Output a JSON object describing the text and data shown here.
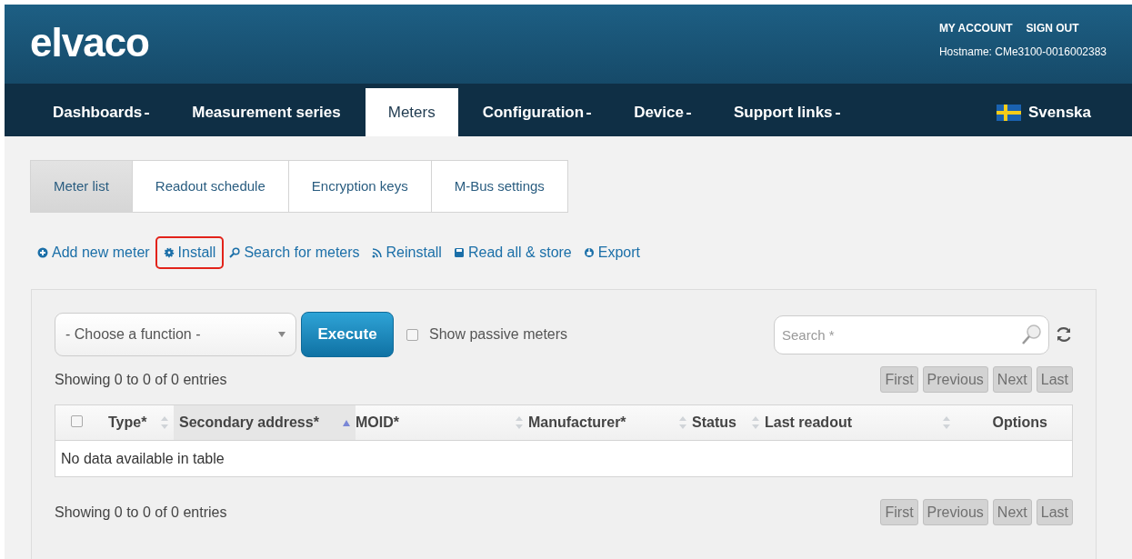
{
  "header": {
    "logo": "elvaco",
    "links": [
      "MY ACCOUNT",
      "SIGN OUT"
    ],
    "hostname": "Hostname: CMe3100-0016002383"
  },
  "nav": [
    {
      "label": "Dashboards",
      "dropdown": true,
      "selected": false
    },
    {
      "label": "Measurement series",
      "dropdown": false,
      "selected": false
    },
    {
      "label": "Meters",
      "dropdown": false,
      "selected": true
    },
    {
      "label": "Configuration",
      "dropdown": true,
      "selected": false
    },
    {
      "label": "Device",
      "dropdown": true,
      "selected": false
    },
    {
      "label": "Support links",
      "dropdown": true,
      "selected": false
    }
  ],
  "language": "Svenska",
  "subtabs": [
    {
      "label": "Meter list",
      "selected": true
    },
    {
      "label": "Readout schedule",
      "selected": false
    },
    {
      "label": "Encryption keys",
      "selected": false
    },
    {
      "label": "M-Bus settings",
      "selected": false
    }
  ],
  "actions": [
    {
      "label": "Add new meter",
      "kind": "plus",
      "highlighted": false
    },
    {
      "label": "Install",
      "kind": "gear",
      "highlighted": true
    },
    {
      "label": "Search for meters",
      "kind": "search",
      "highlighted": false
    },
    {
      "label": "Reinstall",
      "kind": "rss",
      "highlighted": false
    },
    {
      "label": "Read all & store",
      "kind": "disk",
      "highlighted": false
    },
    {
      "label": "Export",
      "kind": "export",
      "highlighted": false
    }
  ],
  "function_select": {
    "value": "- Choose a function -"
  },
  "execute_button": "Execute",
  "show_passive": {
    "label": "Show passive meters",
    "checked": false
  },
  "search": {
    "placeholder": "Search *"
  },
  "info_top": "Showing 0 to 0 of 0 entries",
  "info_bottom": "Showing 0 to 0 of 0 entries",
  "pager_top": [
    {
      "label": "First",
      "disabled": true
    },
    {
      "label": "Previous",
      "disabled": true
    },
    {
      "label": "Next",
      "disabled": true
    },
    {
      "label": "Last",
      "disabled": true
    }
  ],
  "pager_bottom": [
    {
      "label": "First",
      "disabled": true
    },
    {
      "label": "Previous",
      "disabled": true
    },
    {
      "label": "Next",
      "disabled": true
    },
    {
      "label": "Last",
      "disabled": true
    }
  ],
  "table": {
    "select_all_checked": false,
    "columns": [
      {
        "label": "Type*",
        "kind": "sortable"
      },
      {
        "label": "Secondary address*",
        "kind": "sorted"
      },
      {
        "label": "MOID*",
        "kind": "sortable"
      },
      {
        "label": "Manufacturer*",
        "kind": "sortable"
      },
      {
        "label": "Status",
        "kind": "sortable"
      },
      {
        "label": "Last readout",
        "kind": "sortable"
      },
      {
        "label": "Options",
        "kind": "plain"
      }
    ],
    "empty_message": "No data available in table"
  }
}
